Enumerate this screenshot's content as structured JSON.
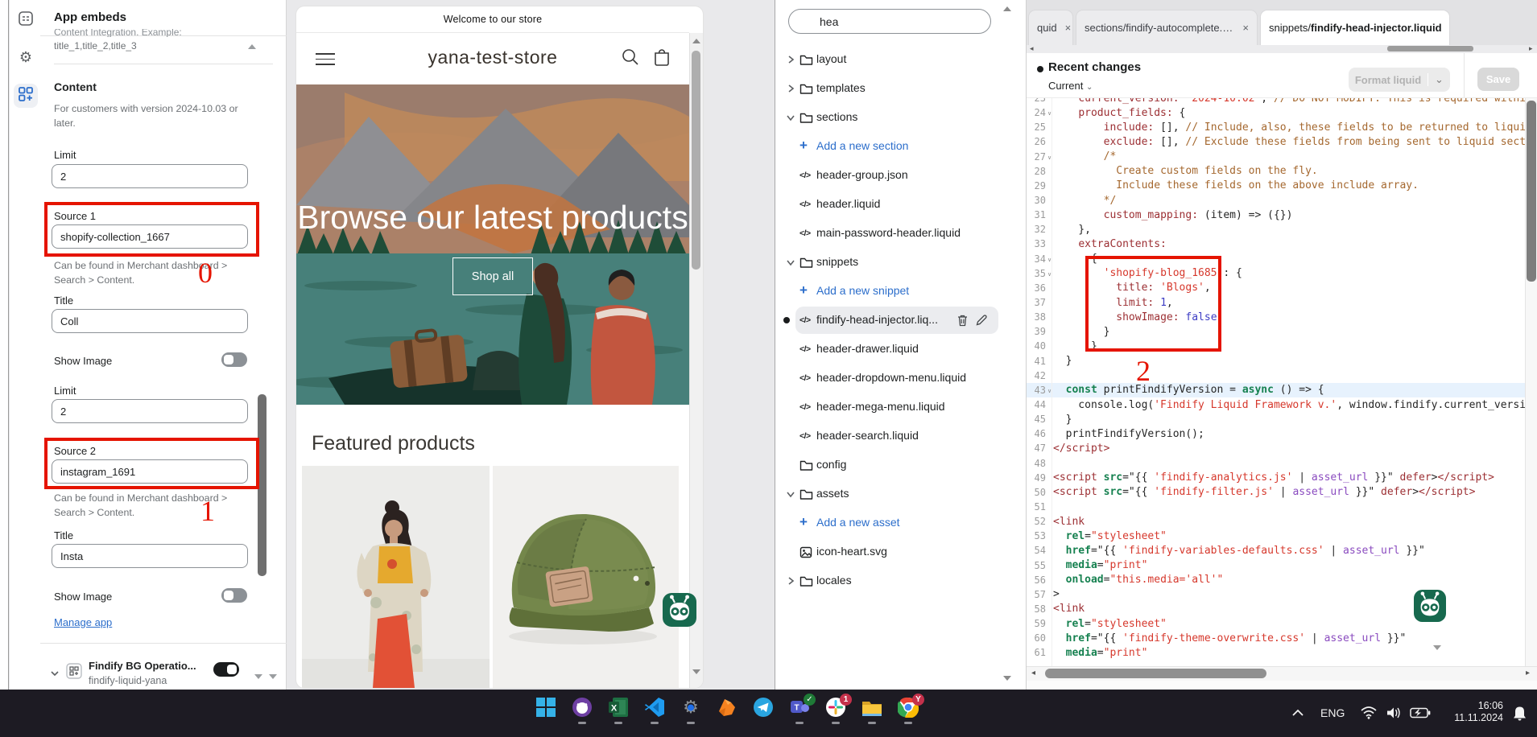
{
  "rail": {
    "icons": [
      "sections-icon",
      "settings-gear-icon",
      "app-embeds-icon"
    ]
  },
  "panel": {
    "title": "App embeds",
    "scrolled_top": "Content Integration. Example:",
    "scrolled_example": "title_1,title_2,title_3",
    "content": {
      "heading": "Content",
      "note": "For customers with version 2024-10.03 or later."
    },
    "limit1": {
      "label": "Limit",
      "value": "2"
    },
    "source1": {
      "label": "Source 1",
      "value": "shopify-collection_1667",
      "help": "Can be found in Merchant dashboard > Search > Content."
    },
    "title1": {
      "label": "Title",
      "value": "Coll"
    },
    "show_image1": {
      "label": "Show Image",
      "on": false
    },
    "limit2": {
      "label": "Limit",
      "value": "2"
    },
    "source2": {
      "label": "Source 2",
      "value": "instagram_1691",
      "help": "Can be found in Merchant dashboard > Search > Content."
    },
    "title2": {
      "label": "Title",
      "value": "Insta"
    },
    "show_image2": {
      "label": "Show Image",
      "on": false
    },
    "manage_app": "Manage app",
    "embed": {
      "name": "Findify BG Operatio...",
      "id": "findify-liquid-yana",
      "enabled": true
    }
  },
  "annotations": {
    "n0": "0",
    "n1": "1",
    "n2": "2",
    "color": "#e51400"
  },
  "preview": {
    "announcement": "Welcome to our store",
    "store_name": "yana-test-store",
    "hero_title": "Browse our latest products",
    "shop_all": "Shop all",
    "featured_heading": "Featured products"
  },
  "file_browser": {
    "search_value": "hea",
    "tree": [
      {
        "label": "layout",
        "type": "folder",
        "chevron": "right"
      },
      {
        "label": "templates",
        "type": "folder",
        "chevron": "right"
      },
      {
        "label": "sections",
        "type": "folder",
        "chevron": "down"
      },
      {
        "label": "Add a new section",
        "type": "add"
      },
      {
        "label": "header-group.json",
        "type": "code"
      },
      {
        "label": "header.liquid",
        "type": "code"
      },
      {
        "label": "main-password-header.liquid",
        "type": "code"
      },
      {
        "label": "snippets",
        "type": "folder",
        "chevron": "down"
      },
      {
        "label": "Add a new snippet",
        "type": "add"
      },
      {
        "label": "findify-head-injector.liq...",
        "type": "code",
        "selected": true,
        "unsaved": true,
        "actions": [
          "trash-icon",
          "edit-icon"
        ]
      },
      {
        "label": "header-drawer.liquid",
        "type": "code"
      },
      {
        "label": "header-dropdown-menu.liquid",
        "type": "code"
      },
      {
        "label": "header-mega-menu.liquid",
        "type": "code"
      },
      {
        "label": "header-search.liquid",
        "type": "code"
      },
      {
        "label": "config",
        "type": "folder",
        "chevron": null
      },
      {
        "label": "assets",
        "type": "folder",
        "chevron": "down"
      },
      {
        "label": "Add a new asset",
        "type": "add"
      },
      {
        "label": "icon-heart.svg",
        "type": "image"
      },
      {
        "label": "locales",
        "type": "folder",
        "chevron": "right"
      }
    ]
  },
  "editor": {
    "tabs": [
      {
        "label": "quid",
        "active": false
      },
      {
        "label": "sections/findify-autocomplete.liquid",
        "active": false
      },
      {
        "prefix": "snippets/",
        "label": "findify-head-injector.liquid",
        "active": true
      }
    ],
    "recent_changes": "Recent changes",
    "version_select": "Current",
    "format_button": "Format liquid",
    "save_button": "Save",
    "code": [
      {
        "n": 23,
        "seg": [
          [
            "p",
            "    "
          ],
          [
            "k",
            "current_version:"
          ],
          [
            "p",
            " "
          ],
          [
            "s",
            "'2024-10.02'"
          ],
          [
            "p",
            ","
          ],
          [
            "c",
            " // DO NOT MODIFY: This is required within s"
          ]
        ]
      },
      {
        "n": 24,
        "fold": true,
        "seg": [
          [
            "p",
            "    "
          ],
          [
            "k",
            "product_fields:"
          ],
          [
            "p",
            " {"
          ]
        ]
      },
      {
        "n": 25,
        "seg": [
          [
            "p",
            "        "
          ],
          [
            "k",
            "include:"
          ],
          [
            "p",
            " [], "
          ],
          [
            "c",
            "// Include, also, these fields to be returned to liquid s"
          ]
        ]
      },
      {
        "n": 26,
        "seg": [
          [
            "p",
            "        "
          ],
          [
            "k",
            "exclude:"
          ],
          [
            "p",
            " [], "
          ],
          [
            "c",
            "// Exclude these fields from being sent to liquid section"
          ]
        ]
      },
      {
        "n": 27,
        "fold": true,
        "seg": [
          [
            "p",
            "        "
          ],
          [
            "c",
            "/*"
          ]
        ]
      },
      {
        "n": 28,
        "seg": [
          [
            "p",
            "          "
          ],
          [
            "c",
            "Create custom fields on the fly."
          ]
        ]
      },
      {
        "n": 29,
        "seg": [
          [
            "p",
            "          "
          ],
          [
            "c",
            "Include these fields on the above include array."
          ]
        ]
      },
      {
        "n": 30,
        "seg": [
          [
            "p",
            "        "
          ],
          [
            "c",
            "*/"
          ]
        ]
      },
      {
        "n": 31,
        "seg": [
          [
            "p",
            "        "
          ],
          [
            "k",
            "custom_mapping:"
          ],
          [
            "p",
            " (item) => ({})"
          ]
        ]
      },
      {
        "n": 32,
        "seg": [
          [
            "p",
            "    },"
          ]
        ]
      },
      {
        "n": 33,
        "seg": [
          [
            "p",
            "    "
          ],
          [
            "k",
            "extraContents:"
          ]
        ]
      },
      {
        "n": 34,
        "fold": true,
        "seg": [
          [
            "p",
            "      {"
          ]
        ]
      },
      {
        "n": 35,
        "fold": true,
        "seg": [
          [
            "p",
            "        "
          ],
          [
            "s",
            "'shopify-blog_1685'"
          ],
          [
            "p",
            ": {"
          ]
        ]
      },
      {
        "n": 36,
        "seg": [
          [
            "p",
            "          "
          ],
          [
            "k",
            "title:"
          ],
          [
            "p",
            " "
          ],
          [
            "s",
            "'Blogs'"
          ],
          [
            "p",
            ","
          ]
        ]
      },
      {
        "n": 37,
        "seg": [
          [
            "p",
            "          "
          ],
          [
            "k",
            "limit:"
          ],
          [
            "p",
            " "
          ],
          [
            "n2",
            "1"
          ],
          [
            "p",
            ","
          ]
        ]
      },
      {
        "n": 38,
        "seg": [
          [
            "p",
            "          "
          ],
          [
            "k",
            "showImage:"
          ],
          [
            "p",
            " "
          ],
          [
            "n2",
            "false"
          ]
        ]
      },
      {
        "n": 39,
        "seg": [
          [
            "p",
            "        }"
          ]
        ]
      },
      {
        "n": 40,
        "seg": [
          [
            "p",
            "      }"
          ]
        ]
      },
      {
        "n": 41,
        "seg": [
          [
            "p",
            "  }"
          ]
        ]
      },
      {
        "n": 42,
        "seg": []
      },
      {
        "n": 43,
        "fold": true,
        "hl": true,
        "seg": [
          [
            "p",
            "  "
          ],
          [
            "g",
            "const"
          ],
          [
            "p",
            " printFindifyVersion = "
          ],
          [
            "g",
            "async"
          ],
          [
            "p",
            " () => {"
          ]
        ]
      },
      {
        "n": 44,
        "seg": [
          [
            "p",
            "    console.log("
          ],
          [
            "s",
            "'Findify Liquid Framework v.'"
          ],
          [
            "p",
            ", window.findify.current_version)"
          ]
        ]
      },
      {
        "n": 45,
        "seg": [
          [
            "p",
            "  }"
          ]
        ]
      },
      {
        "n": 46,
        "seg": [
          [
            "p",
            "  printFindifyVersion();"
          ]
        ]
      },
      {
        "n": 47,
        "seg": [
          [
            "k",
            "</script>"
          ]
        ]
      },
      {
        "n": 48,
        "seg": []
      },
      {
        "n": 49,
        "seg": [
          [
            "k",
            "<script"
          ],
          [
            "p",
            " "
          ],
          [
            "g",
            "src"
          ],
          [
            "p",
            "=\"{{ "
          ],
          [
            "s",
            "'findify-analytics.js'"
          ],
          [
            "p",
            " | "
          ],
          [
            "v",
            "asset_url"
          ],
          [
            "p",
            " }}\" "
          ],
          [
            "k",
            "defer"
          ],
          [
            "p",
            ">"
          ],
          [
            "k",
            "</script>"
          ]
        ]
      },
      {
        "n": 50,
        "seg": [
          [
            "k",
            "<script"
          ],
          [
            "p",
            " "
          ],
          [
            "g",
            "src"
          ],
          [
            "p",
            "=\"{{ "
          ],
          [
            "s",
            "'findify-filter.js'"
          ],
          [
            "p",
            " | "
          ],
          [
            "v",
            "asset_url"
          ],
          [
            "p",
            " }}\" "
          ],
          [
            "k",
            "defer"
          ],
          [
            "p",
            ">"
          ],
          [
            "k",
            "</script>"
          ]
        ]
      },
      {
        "n": 51,
        "seg": []
      },
      {
        "n": 52,
        "seg": [
          [
            "k",
            "<link"
          ]
        ]
      },
      {
        "n": 53,
        "seg": [
          [
            "p",
            "  "
          ],
          [
            "g",
            "rel"
          ],
          [
            "p",
            "="
          ],
          [
            "s",
            "\"stylesheet\""
          ]
        ]
      },
      {
        "n": 54,
        "seg": [
          [
            "p",
            "  "
          ],
          [
            "g",
            "href"
          ],
          [
            "p",
            "=\"{{ "
          ],
          [
            "s",
            "'findify-variables-defaults.css'"
          ],
          [
            "p",
            " | "
          ],
          [
            "v",
            "asset_url"
          ],
          [
            "p",
            " }}\""
          ]
        ]
      },
      {
        "n": 55,
        "seg": [
          [
            "p",
            "  "
          ],
          [
            "g",
            "media"
          ],
          [
            "p",
            "="
          ],
          [
            "s",
            "\"print\""
          ]
        ]
      },
      {
        "n": 56,
        "seg": [
          [
            "p",
            "  "
          ],
          [
            "g",
            "onload"
          ],
          [
            "p",
            "="
          ],
          [
            "s",
            "\"this.media='all'\""
          ]
        ]
      },
      {
        "n": 57,
        "seg": [
          [
            "p",
            ">"
          ]
        ]
      },
      {
        "n": 58,
        "seg": [
          [
            "k",
            "<link"
          ]
        ]
      },
      {
        "n": 59,
        "seg": [
          [
            "p",
            "  "
          ],
          [
            "g",
            "rel"
          ],
          [
            "p",
            "="
          ],
          [
            "s",
            "\"stylesheet\""
          ]
        ]
      },
      {
        "n": 60,
        "seg": [
          [
            "p",
            "  "
          ],
          [
            "g",
            "href"
          ],
          [
            "p",
            "=\"{{ "
          ],
          [
            "s",
            "'findify-theme-overwrite.css'"
          ],
          [
            "p",
            " | "
          ],
          [
            "v",
            "asset_url"
          ],
          [
            "p",
            " }}\""
          ]
        ]
      },
      {
        "n": 61,
        "seg": [
          [
            "p",
            "  "
          ],
          [
            "g",
            "media"
          ],
          [
            "p",
            "="
          ],
          [
            "s",
            "\"print\""
          ]
        ]
      }
    ]
  },
  "taskbar": {
    "apps": [
      {
        "name": "windows-start-icon"
      },
      {
        "name": "github-icon",
        "running": true
      },
      {
        "name": "excel-icon",
        "running": true
      },
      {
        "name": "vscode-icon",
        "running": true
      },
      {
        "name": "settings-app-icon",
        "running": true
      },
      {
        "name": "fox-browser-icon"
      },
      {
        "name": "telegram-icon"
      },
      {
        "name": "teams-icon",
        "running": true,
        "badge": "check"
      },
      {
        "name": "slack-icon",
        "running": true,
        "badge": "1"
      },
      {
        "name": "file-explorer-icon",
        "running": true
      },
      {
        "name": "chrome-icon",
        "running": true,
        "badge": "Y"
      }
    ],
    "tray": {
      "language": "ENG",
      "time": "16:06",
      "date": "11.11.2024"
    }
  }
}
